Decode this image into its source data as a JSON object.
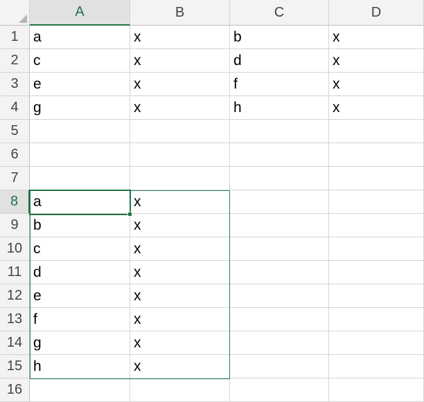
{
  "sheet": {
    "columns": [
      "A",
      "B",
      "C",
      "D"
    ],
    "rows": [
      "1",
      "2",
      "3",
      "4",
      "5",
      "6",
      "7",
      "8",
      "9",
      "10",
      "11",
      "12",
      "13",
      "14",
      "15",
      "16"
    ],
    "selected_column": "A",
    "selected_row": "8",
    "active_cell": "A8",
    "selected_range": "A8:B15",
    "accent_color": "#217346",
    "cells": [
      [
        "a",
        "x",
        "b",
        "x"
      ],
      [
        "c",
        "x",
        "d",
        "x"
      ],
      [
        "e",
        "x",
        "f",
        "x"
      ],
      [
        "g",
        "x",
        "h",
        "x"
      ],
      [
        "",
        "",
        "",
        ""
      ],
      [
        "",
        "",
        "",
        ""
      ],
      [
        "",
        "",
        "",
        ""
      ],
      [
        "a",
        "x",
        "",
        ""
      ],
      [
        "b",
        "x",
        "",
        ""
      ],
      [
        "c",
        "x",
        "",
        ""
      ],
      [
        "d",
        "x",
        "",
        ""
      ],
      [
        "e",
        "x",
        "",
        ""
      ],
      [
        "f",
        "x",
        "",
        ""
      ],
      [
        "g",
        "x",
        "",
        ""
      ],
      [
        "h",
        "x",
        "",
        ""
      ],
      [
        "",
        "",
        "",
        ""
      ]
    ]
  }
}
